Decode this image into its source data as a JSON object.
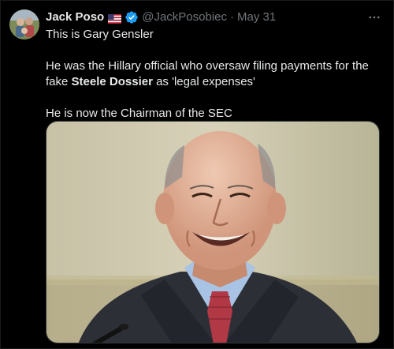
{
  "tweet": {
    "display_name": "Jack Poso",
    "flag_icon": "us-flag-icon",
    "verified_icon": "verified-badge-icon",
    "handle": "@JackPosobiec",
    "separator": "·",
    "timestamp": "May 31",
    "more_icon": "more-horizontal-icon",
    "lines": {
      "line1": "This is Gary Gensler",
      "line2_part1": "He was the Hillary official who oversaw filing payments for the fake ",
      "line2_bold": "Steele Dossier",
      "line2_part2": " as 'legal expenses'",
      "line3": "He is now the Chairman of the SEC"
    },
    "accent_color": "#1d9bf0",
    "text_color": "#e7e9ea",
    "muted_color": "#71767b"
  }
}
